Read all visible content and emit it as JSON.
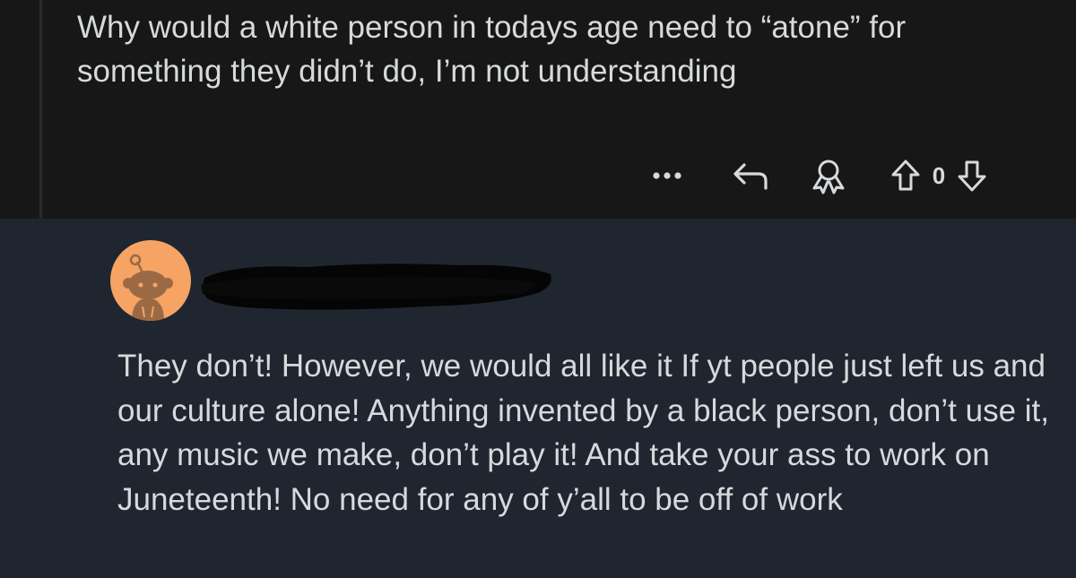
{
  "parent_comment": {
    "body": "Why would a white person in todays age need to “atone” for something they didn’t do, I’m not understanding",
    "actions": {
      "more_icon": "more-dots-icon",
      "reply_icon": "reply-arrow-icon",
      "award_icon": "award-icon",
      "upvote_icon": "upvote-arrow-icon",
      "vote_count": "0",
      "downvote_icon": "downvote-arrow-icon"
    }
  },
  "reply_comment": {
    "avatar_icon": "snoo-avatar-icon",
    "body": "They don’t! However, we would all like it If yt people just left us and our culture alone! Anything invented by a black person, don’t use it, any music we make, don’t play it! And take your ass to work on Juneteenth! No need for any of y’all to be off of work"
  },
  "colors": {
    "parent_background": "#171717",
    "reply_background": "#1f2630",
    "text": "#d7dadc",
    "avatar_background": "#f6a364",
    "avatar_figure": "#9b6a45"
  }
}
